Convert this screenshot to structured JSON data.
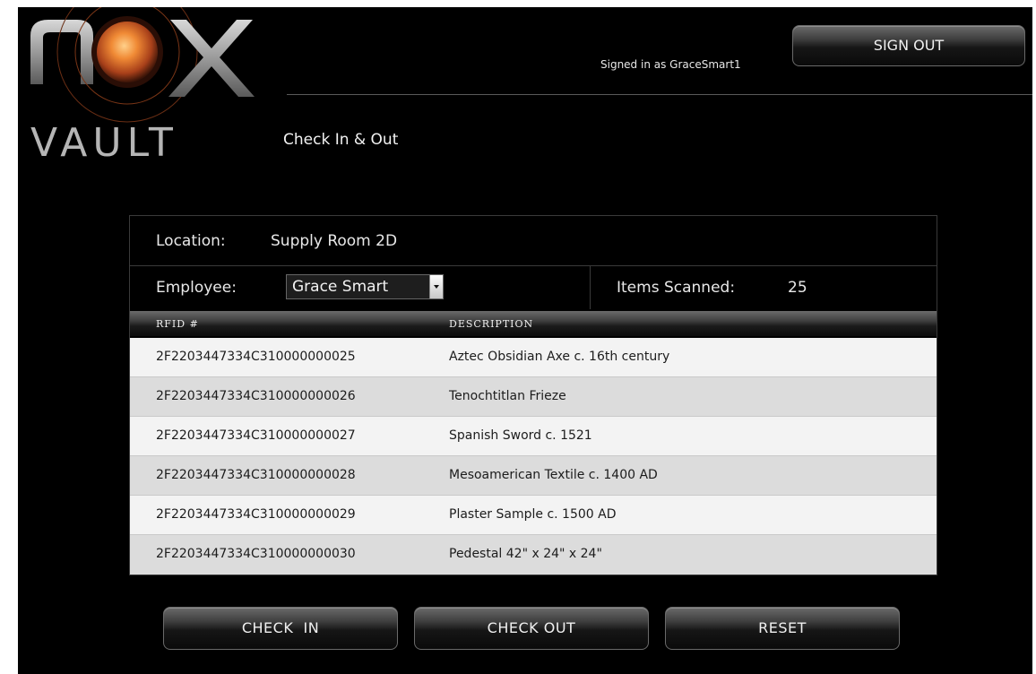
{
  "brand": {
    "line1": "nox",
    "line2": "VAULT"
  },
  "header": {
    "signed_in_text": "Signed in as GraceSmart1",
    "sign_out_label": "SIGN OUT"
  },
  "page": {
    "title": "Check In & Out"
  },
  "panel": {
    "location_label": "Location:",
    "location_value": "Supply Room 2D",
    "employee_label": "Employee:",
    "employee_selected": "Grace Smart",
    "items_scanned_label": "Items Scanned:",
    "items_scanned_value": "25"
  },
  "table": {
    "columns": [
      "RFID #",
      "DESCRIPTION"
    ],
    "rows": [
      {
        "rfid": "2F2203447334C310000000025",
        "description": "Aztec Obsidian Axe c. 16th century"
      },
      {
        "rfid": "2F2203447334C310000000026",
        "description": "Tenochtitlan Frieze"
      },
      {
        "rfid": "2F2203447334C310000000027",
        "description": "Spanish Sword c. 1521"
      },
      {
        "rfid": "2F2203447334C310000000028",
        "description": "Mesoamerican Textile c. 1400 AD"
      },
      {
        "rfid": "2F2203447334C310000000029",
        "description": "Plaster Sample c. 1500 AD"
      },
      {
        "rfid": "2F2203447334C310000000030",
        "description": "Pedestal 42\" x 24\" x 24\""
      }
    ]
  },
  "actions": {
    "check_in_label": "CHECK  IN",
    "check_out_label": "CHECK OUT",
    "reset_label": "RESET"
  },
  "colors": {
    "background": "#000000",
    "accent_orange": "#e8782a",
    "row_light": "#f3f3f3",
    "row_dark": "#dcdcdc"
  },
  "icons": {
    "select_arrow": "chevron-down-icon"
  }
}
